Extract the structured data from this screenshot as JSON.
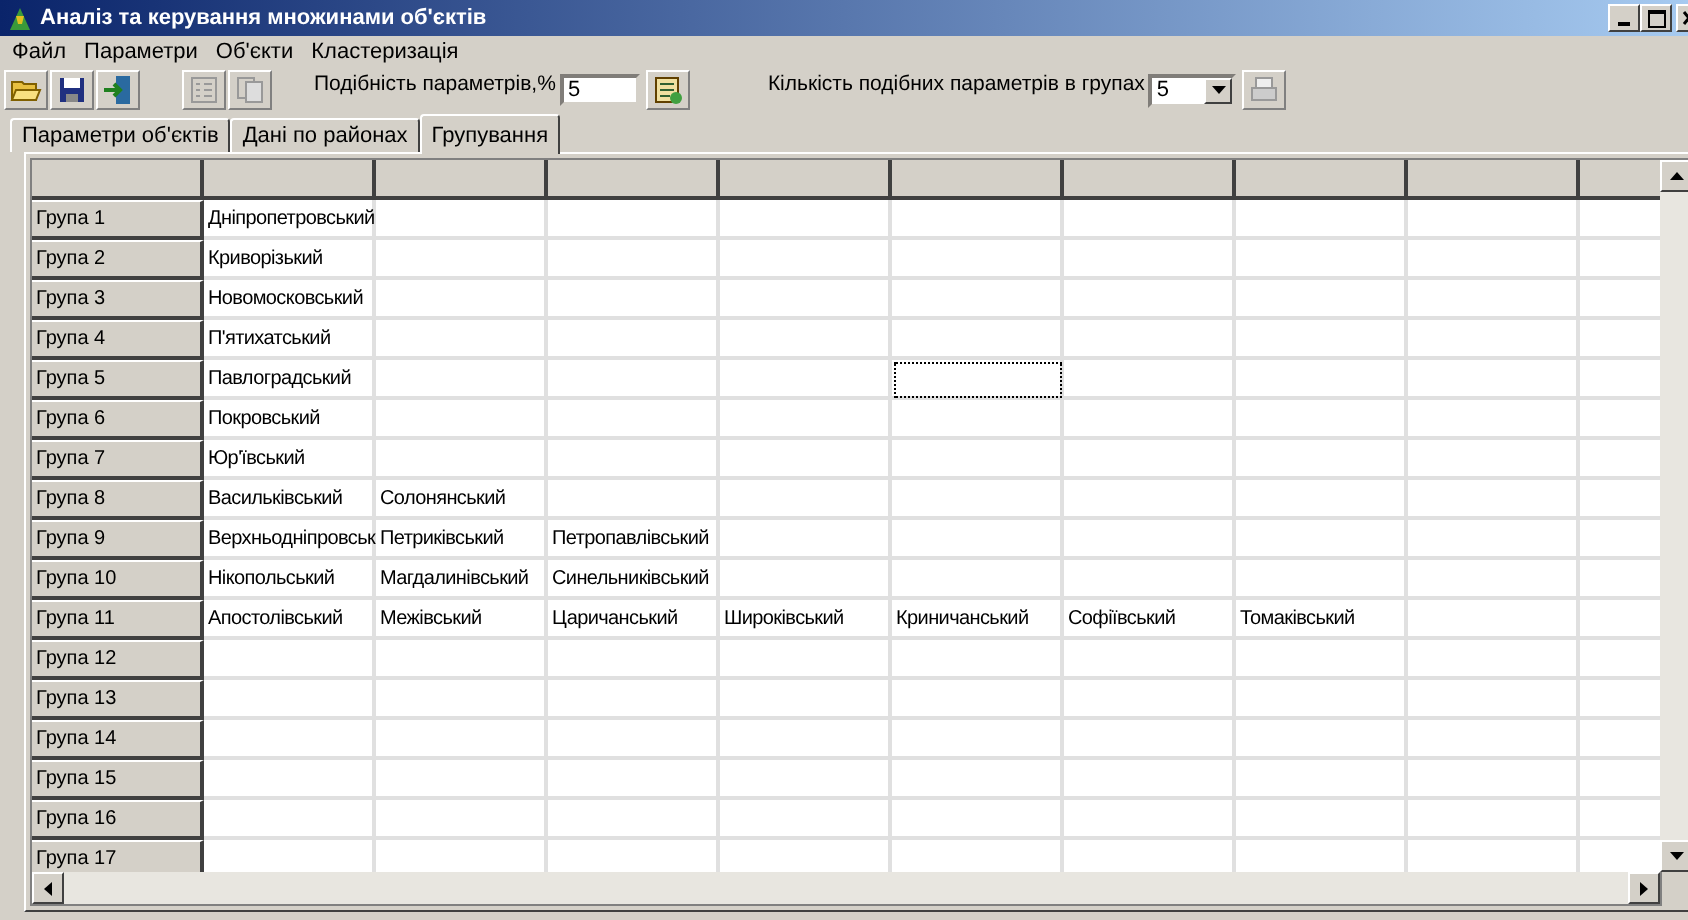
{
  "window": {
    "title": "Аналіз та керування множинами об'єктів"
  },
  "menu": [
    "Файл",
    "Параметри",
    "Об'єкти",
    "Кластеризація"
  ],
  "toolbar": {
    "similarity_label": "Подібність параметрів,%",
    "similarity_value": "5",
    "count_label": "Кількість подібних параметрів в групах",
    "count_value": "5"
  },
  "tabs": [
    {
      "label": "Параметри об'єктів",
      "selected": false
    },
    {
      "label": "Дані по районах",
      "selected": false
    },
    {
      "label": "Групування",
      "selected": true
    }
  ],
  "table": {
    "rows": [
      {
        "header": "Група 1",
        "cells": [
          {
            "text": "Дніпропетровський",
            "focused": false
          },
          {
            "focused": false
          },
          {
            "focused": false
          },
          {
            "focused": false
          },
          {
            "focused": false
          },
          {
            "focused": false
          },
          {
            "focused": false
          },
          {
            "focused": false
          }
        ]
      },
      {
        "header": "Група 2",
        "cells": [
          {
            "text": "Криворізький",
            "focused": false
          },
          {
            "focused": false
          },
          {
            "focused": false
          },
          {
            "focused": false
          },
          {
            "focused": false
          },
          {
            "focused": false
          },
          {
            "focused": false
          },
          {
            "focused": false
          }
        ]
      },
      {
        "header": "Група 3",
        "cells": [
          {
            "text": "Новомосковський",
            "focused": false
          },
          {
            "focused": false
          },
          {
            "focused": false
          },
          {
            "focused": false
          },
          {
            "focused": false
          },
          {
            "focused": false
          },
          {
            "focused": false
          },
          {
            "focused": false
          }
        ]
      },
      {
        "header": "Група 4",
        "cells": [
          {
            "text": "П'ятихатський",
            "focused": false
          },
          {
            "focused": false
          },
          {
            "focused": false
          },
          {
            "focused": false
          },
          {
            "focused": false
          },
          {
            "focused": false
          },
          {
            "focused": false
          },
          {
            "focused": false
          }
        ]
      },
      {
        "header": "Група 5",
        "cells": [
          {
            "text": "Павлоградський",
            "focused": false
          },
          {
            "focused": false
          },
          {
            "focused": false
          },
          {
            "focused": false
          },
          {
            "focused": true
          },
          {
            "focused": false
          },
          {
            "focused": false
          },
          {
            "focused": false
          }
        ]
      },
      {
        "header": "Група 6",
        "cells": [
          {
            "text": "Покровський",
            "focused": false
          },
          {
            "focused": false
          },
          {
            "focused": false
          },
          {
            "focused": false
          },
          {
            "focused": false
          },
          {
            "focused": false
          },
          {
            "focused": false
          },
          {
            "focused": false
          }
        ]
      },
      {
        "header": "Група 7",
        "cells": [
          {
            "text": "Юр'ївський",
            "focused": false
          },
          {
            "focused": false
          },
          {
            "focused": false
          },
          {
            "focused": false
          },
          {
            "focused": false
          },
          {
            "focused": false
          },
          {
            "focused": false
          },
          {
            "focused": false
          }
        ]
      },
      {
        "header": "Група 8",
        "cells": [
          {
            "text": "Васильківський",
            "focused": false
          },
          {
            "text": "Солонянський",
            "focused": false
          },
          {
            "focused": false
          },
          {
            "focused": false
          },
          {
            "focused": false
          },
          {
            "focused": false
          },
          {
            "focused": false
          },
          {
            "focused": false
          }
        ]
      },
      {
        "header": "Група 9",
        "cells": [
          {
            "text": "Верхньодніпровськ",
            "focused": false
          },
          {
            "text": "Петриківський",
            "focused": false
          },
          {
            "text": "Петропавлівський",
            "focused": false
          },
          {
            "focused": false
          },
          {
            "focused": false
          },
          {
            "focused": false
          },
          {
            "focused": false
          },
          {
            "focused": false
          }
        ]
      },
      {
        "header": "Група 10",
        "cells": [
          {
            "text": "Нікопольський",
            "focused": false
          },
          {
            "text": "Магдалинівський",
            "focused": false
          },
          {
            "text": "Синельниківський",
            "focused": false
          },
          {
            "focused": false
          },
          {
            "focused": false
          },
          {
            "focused": false
          },
          {
            "focused": false
          },
          {
            "focused": false
          }
        ]
      },
      {
        "header": "Група 11",
        "cells": [
          {
            "text": "Апостолівський",
            "focused": false
          },
          {
            "text": "Межівський",
            "focused": false
          },
          {
            "text": "Царичанський",
            "focused": false
          },
          {
            "text": "Широківський",
            "focused": false
          },
          {
            "text": "Криничанський",
            "focused": false
          },
          {
            "text": "Софіївський",
            "focused": false
          },
          {
            "text": "Томаківський",
            "focused": false
          },
          {
            "focused": false
          }
        ]
      },
      {
        "header": "Група 12",
        "cells": [
          {
            "focused": false
          },
          {
            "focused": false
          },
          {
            "focused": false
          },
          {
            "focused": false
          },
          {
            "focused": false
          },
          {
            "focused": false
          },
          {
            "focused": false
          },
          {
            "focused": false
          }
        ]
      },
      {
        "header": "Група 13",
        "cells": [
          {
            "focused": false
          },
          {
            "focused": false
          },
          {
            "focused": false
          },
          {
            "focused": false
          },
          {
            "focused": false
          },
          {
            "focused": false
          },
          {
            "focused": false
          },
          {
            "focused": false
          }
        ]
      },
      {
        "header": "Група 14",
        "cells": [
          {
            "focused": false
          },
          {
            "focused": false
          },
          {
            "focused": false
          },
          {
            "focused": false
          },
          {
            "focused": false
          },
          {
            "focused": false
          },
          {
            "focused": false
          },
          {
            "focused": false
          }
        ]
      },
      {
        "header": "Група 15",
        "cells": [
          {
            "focused": false
          },
          {
            "focused": false
          },
          {
            "focused": false
          },
          {
            "focused": false
          },
          {
            "focused": false
          },
          {
            "focused": false
          },
          {
            "focused": false
          },
          {
            "focused": false
          }
        ]
      },
      {
        "header": "Група 16",
        "cells": [
          {
            "focused": false
          },
          {
            "focused": false
          },
          {
            "focused": false
          },
          {
            "focused": false
          },
          {
            "focused": false
          },
          {
            "focused": false
          },
          {
            "focused": false
          },
          {
            "focused": false
          }
        ]
      },
      {
        "header": "Група 17",
        "cells": [
          {
            "focused": false
          },
          {
            "focused": false
          },
          {
            "focused": false
          },
          {
            "focused": false
          },
          {
            "focused": false
          },
          {
            "focused": false
          },
          {
            "focused": false
          },
          {
            "focused": false
          }
        ]
      }
    ]
  }
}
